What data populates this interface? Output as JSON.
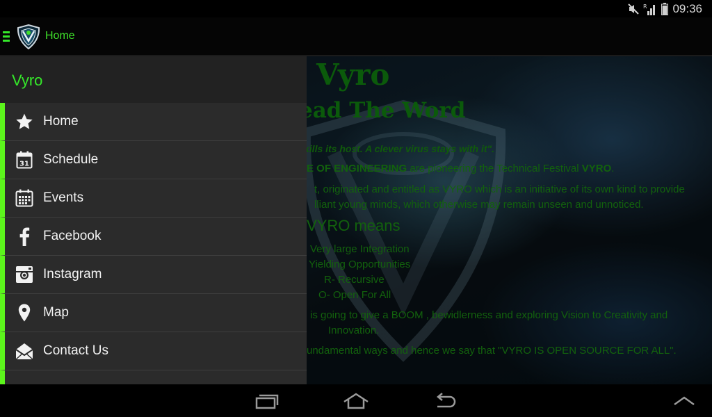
{
  "status_bar": {
    "time": "09:36",
    "icons": [
      "mute-icon",
      "signal-r-icon",
      "battery-icon"
    ]
  },
  "action_bar": {
    "title": "Home",
    "accent": "#35e82a"
  },
  "content": {
    "title": "Vyro",
    "subtitle": "ead The Word",
    "quote": "kills its host. A clever virus stays with it\".",
    "para1_a": "E OF ENGINEERING",
    "para1_b": " are pioneering the Technical Festival ",
    "para1_c": "VYRO",
    "para1_d": ".",
    "para2_line1": "t, originated and entitled as VYRO which is an initiative of its own kind to provide",
    "para2_line2": "lliant young minds, which otherwise may remain unseen and unnoticed.",
    "means_heading": "VYRO means",
    "means_list": [
      "Very large Integration",
      "Yielding Opportunities",
      "R- Recursive",
      "O- Open For All"
    ],
    "para3_line1": "is going to give a BOOM , bewidlerness and exploring Vision to Creativity and",
    "para3_line2": "Innovation.",
    "para4": "undamental ways and hence we say that \"VYRO IS OPEN SOURCE FOR ALL\"."
  },
  "drawer": {
    "title": "Vyro",
    "items": [
      {
        "label": "Home",
        "icon": "star-icon"
      },
      {
        "label": "Schedule",
        "icon": "calendar-31-icon"
      },
      {
        "label": "Events",
        "icon": "calendar-grid-icon"
      },
      {
        "label": "Facebook",
        "icon": "facebook-icon"
      },
      {
        "label": "Instagram",
        "icon": "instagram-icon"
      },
      {
        "label": "Map",
        "icon": "map-pin-icon"
      },
      {
        "label": "Contact Us",
        "icon": "envelope-icon"
      }
    ],
    "calendar_day": "31"
  },
  "nav_bar": {
    "buttons": [
      "recent-apps-icon",
      "home-icon",
      "back-icon",
      "menu-up-icon"
    ]
  }
}
